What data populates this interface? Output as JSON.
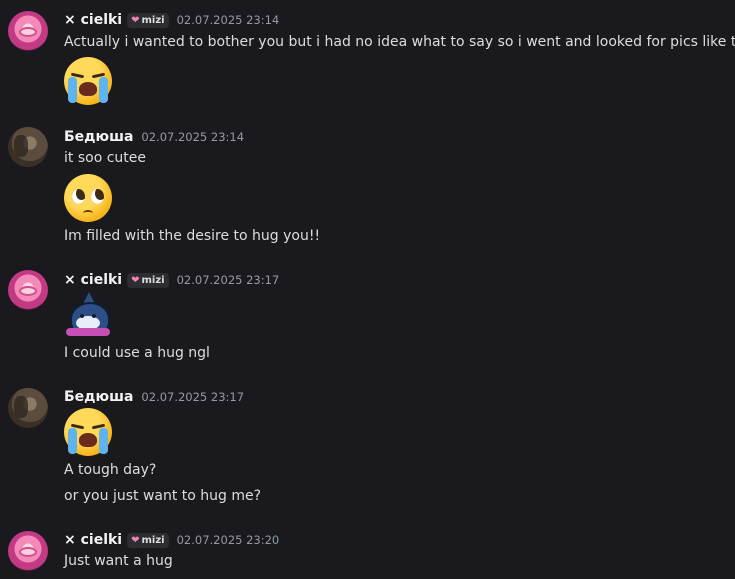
{
  "messages": [
    {
      "username": "× cielki",
      "tag": "mizi",
      "timestamp": "02.07.2025 23:14",
      "lines": [
        "Actually i wanted to bother you but i had no idea what to say so i went and looked for pics like that"
      ],
      "attachment": "loudly-crying-emoji"
    },
    {
      "username": "Бедюша",
      "timestamp": "02.07.2025 23:14",
      "lines": [
        "it soo cutee",
        "Im filled with the desire to hug you!!"
      ],
      "attachment": "pleading-face-emoji"
    },
    {
      "username": "× cielki",
      "tag": "mizi",
      "timestamp": "02.07.2025 23:17",
      "lines": [
        "I could use a hug ngl"
      ],
      "attachment": "shark-sticker"
    },
    {
      "username": "Бедюша",
      "timestamp": "02.07.2025 23:17",
      "lines": [
        "A tough day?",
        "or you just want to hug me?"
      ],
      "attachment": "loudly-crying-emoji"
    },
    {
      "username": "× cielki",
      "tag": "mizi",
      "timestamp": "02.07.2025 23:20",
      "lines": [
        "Just want a hug"
      ]
    }
  ],
  "colors": {
    "background": "#1a1a1e",
    "username": "#f2f3f5",
    "text": "#dbdee1",
    "timestamp": "#949ba4",
    "tag_heart": "#f47fb1"
  }
}
